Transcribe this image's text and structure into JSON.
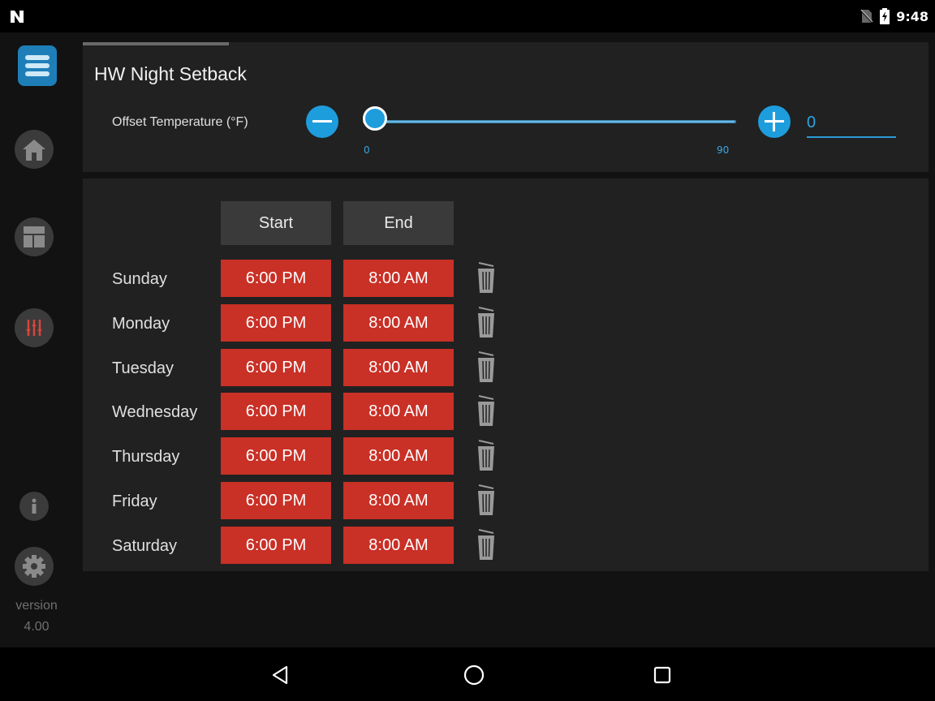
{
  "status_bar": {
    "time": "9:48",
    "icons": [
      "n-logo-icon",
      "no-sim-icon",
      "battery-charging-icon"
    ]
  },
  "sidebar": {
    "items": [
      {
        "name": "menu",
        "icon": "menu-icon",
        "color": "#1e7fb8"
      },
      {
        "name": "home",
        "icon": "home-icon"
      },
      {
        "name": "dashboard",
        "icon": "dashboard-icon"
      },
      {
        "name": "adjustments",
        "icon": "sliders-icon",
        "color": "#d9453b"
      },
      {
        "name": "info",
        "icon": "info-icon"
      },
      {
        "name": "settings",
        "icon": "gear-icon"
      }
    ],
    "version_label": "version",
    "version_number": "4.00"
  },
  "header": {
    "title": "HW Night Setback"
  },
  "offset": {
    "label": "Offset Temperature (°F)",
    "min": "0",
    "max": "90",
    "value": "0",
    "slider_fraction": 0.0,
    "accent": "#1e9ddd"
  },
  "schedule": {
    "headers": {
      "start": "Start",
      "end": "End"
    },
    "rows": [
      {
        "day": "Sunday",
        "start": "6:00 PM",
        "end": "8:00 AM"
      },
      {
        "day": "Monday",
        "start": "6:00 PM",
        "end": "8:00 AM"
      },
      {
        "day": "Tuesday",
        "start": "6:00 PM",
        "end": "8:00 AM"
      },
      {
        "day": "Wednesday",
        "start": "6:00 PM",
        "end": "8:00 AM"
      },
      {
        "day": "Thursday",
        "start": "6:00 PM",
        "end": "8:00 AM"
      },
      {
        "day": "Friday",
        "start": "6:00 PM",
        "end": "8:00 AM"
      },
      {
        "day": "Saturday",
        "start": "6:00 PM",
        "end": "8:00 AM"
      }
    ],
    "cell_color": "#c93026"
  },
  "system_nav": {
    "icons": [
      "back-icon",
      "home-circle-icon",
      "recents-icon"
    ]
  }
}
